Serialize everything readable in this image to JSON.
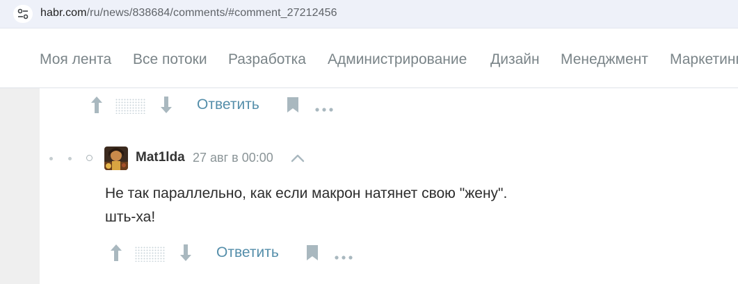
{
  "browser": {
    "url_host": "habr.com",
    "url_path": "/ru/news/838684/comments/#comment_27212456",
    "site_icon": "site-settings-icon"
  },
  "nav": {
    "items": [
      {
        "label": "Моя лента"
      },
      {
        "label": "Все потоки"
      },
      {
        "label": "Разработка"
      },
      {
        "label": "Администрирование"
      },
      {
        "label": "Дизайн"
      },
      {
        "label": "Менеджмент"
      },
      {
        "label": "Маркетинг"
      }
    ]
  },
  "parent_actions": {
    "reply_label": "Ответить",
    "icons": [
      "arrow-up-icon",
      "score-hidden-icon",
      "arrow-down-icon",
      "bookmark-icon",
      "more-icon"
    ]
  },
  "comment": {
    "username": "Mat1lda",
    "timestamp": "27 авг в 00:00",
    "lines": [
      "Не так параллельно, как если макрон натянет свою \"жену\".",
      "шть-ха!"
    ],
    "reply_label": "Ответить",
    "icons": [
      "avatar",
      "chevron-up-icon",
      "arrow-up-icon",
      "score-hidden-icon",
      "arrow-down-icon",
      "bookmark-icon",
      "more-icon"
    ]
  },
  "colors": {
    "accent_link": "#548eaa",
    "nav_text": "#7a8488",
    "icon": "#a9b8bf"
  }
}
